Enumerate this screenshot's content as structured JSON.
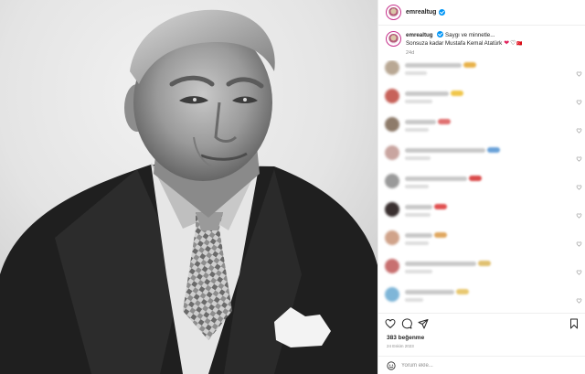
{
  "post": {
    "username": "emrealtug",
    "caption_line1": "Saygı ve minnetle...",
    "caption_line2": "Sonsuza kadar Mustafa Kemal Atatürk",
    "caption_heart_red": "❤",
    "caption_heart_outline": "♡",
    "caption_tail": "🇹🇷",
    "time_ago": "24d",
    "likes": "383 beğenme",
    "date": "24 Eskim 2023"
  },
  "icons": {
    "like": "heart-icon",
    "comment": "comment-icon",
    "share": "share-icon",
    "save": "bookmark-icon",
    "emoji": "smiley-icon",
    "verified": "verified-badge-icon"
  },
  "comment_box": {
    "placeholder": "Yorum ekle..."
  },
  "colors": {
    "verified": "#0095f6",
    "avatar_ring": "#c7318c",
    "heart_red": "#e0245e",
    "text": "#262626",
    "muted": "#8e8e8e"
  },
  "comments": [
    {
      "avatar_color": "#b9a894",
      "emoji_color": "#e8b24a",
      "line1_width": 62,
      "line2_width": 24
    },
    {
      "avatar_color": "#c7625a",
      "emoji_color": "#f0c64a",
      "line1_width": 48,
      "line2_width": 30
    },
    {
      "avatar_color": "#8e7b6a",
      "emoji_color": "#e07070",
      "line1_width": 34,
      "line2_width": 26
    },
    {
      "avatar_color": "#c9a5a0",
      "emoji_color": "#6aa2d8",
      "line1_width": 88,
      "line2_width": 28
    },
    {
      "avatar_color": "#9a9a9a",
      "emoji_color": "#d94a4a",
      "line1_width": 68,
      "line2_width": 26
    },
    {
      "avatar_color": "#3a3030",
      "emoji_color": "#e05050",
      "line1_width": 30,
      "line2_width": 28
    },
    {
      "avatar_color": "#d0a38a",
      "emoji_color": "#e0a860",
      "line1_width": 30,
      "line2_width": 26
    },
    {
      "avatar_color": "#c87070",
      "emoji_color": "#e0c070",
      "line1_width": 78,
      "line2_width": 30
    },
    {
      "avatar_color": "#7fb6d8",
      "emoji_color": "#e8c870",
      "line1_width": 54,
      "line2_width": 20
    }
  ]
}
